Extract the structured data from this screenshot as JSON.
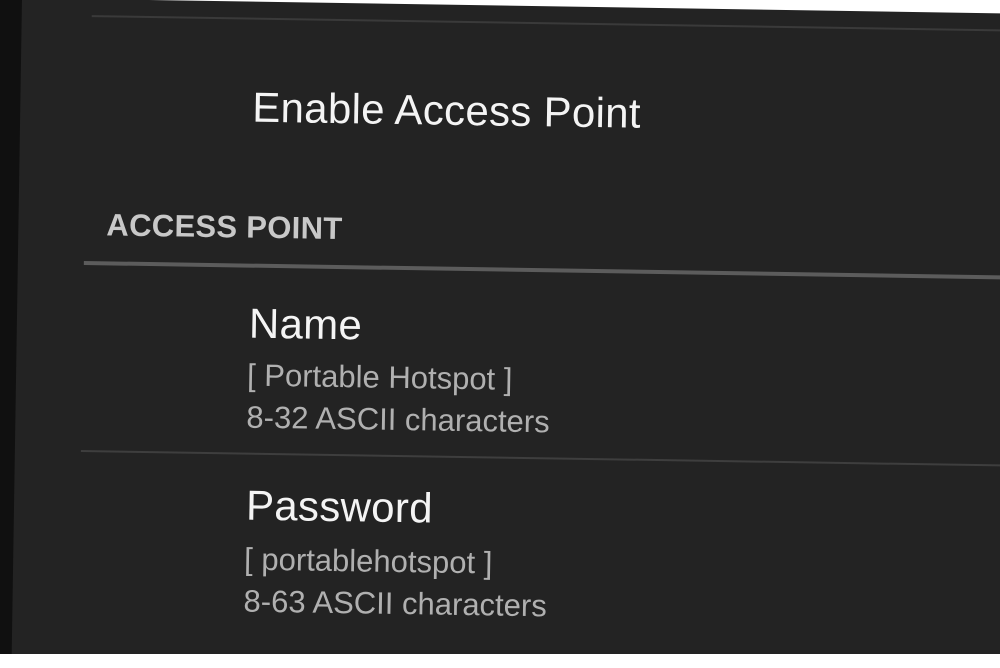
{
  "enable_access_point": {
    "title": "Enable Access Point"
  },
  "section": {
    "header": "ACCESS POINT"
  },
  "name_setting": {
    "title": "Name",
    "value": "[ Portable Hotspot ]",
    "hint": "8-32 ASCII characters"
  },
  "password_setting": {
    "title": "Password",
    "value": "[ portablehotspot ]",
    "hint": "8-63 ASCII characters"
  }
}
